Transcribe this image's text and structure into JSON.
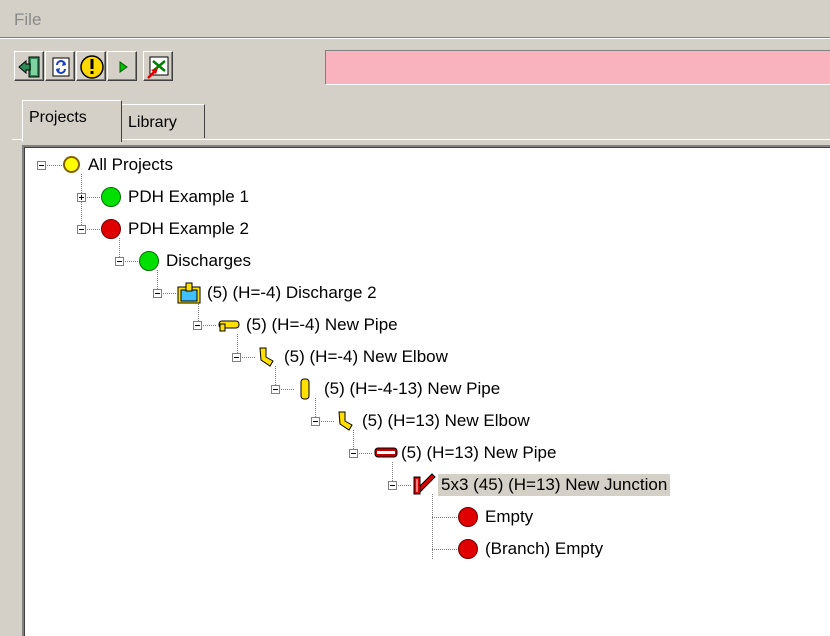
{
  "menu": {
    "file_label": "File"
  },
  "toolbar": {
    "buttons": [
      "exit-icon",
      "refresh-icon",
      "warning-icon",
      "play-icon",
      "excel-export-icon"
    ],
    "status_color": "#f8b3be"
  },
  "tabs": [
    {
      "label": "Projects",
      "active": true
    },
    {
      "label": "Library",
      "active": false
    }
  ],
  "tree": {
    "root": "All Projects",
    "project1": "PDH Example 1",
    "project2": "PDH Example 2",
    "discharges": "Discharges",
    "discharge2": "(5) (H=-4) Discharge 2",
    "pipe1": "(5) (H=-4) New Pipe",
    "elbow1": "(5) (H=-4) New Elbow",
    "pipe2": "(5) (H=-4-13) New Pipe",
    "elbow2": "(5) (H=13) New Elbow",
    "pipe3": "(5) (H=13) New Pipe",
    "junction": "5x3 (45)  (H=13) New Junction",
    "empty": "Empty",
    "branch_empty": "(Branch) Empty"
  },
  "colors": {
    "status_green": "#00e000",
    "status_red": "#e00000",
    "status_yellow": "#ffff00",
    "selection": "#d4d0c8"
  }
}
